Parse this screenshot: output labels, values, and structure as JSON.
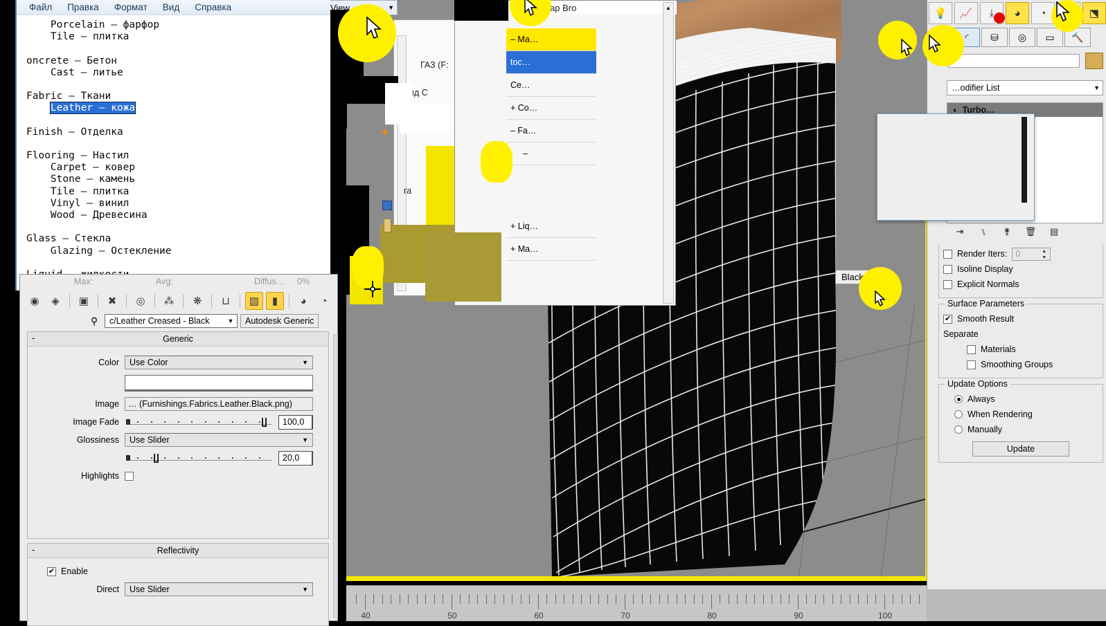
{
  "notepad": {
    "menu": [
      "Файл",
      "Правка",
      "Формат",
      "Вид",
      "Справка"
    ],
    "lines": [
      {
        "text": "    Porcelain – фарфор",
        "selected": false
      },
      {
        "text": "    Tile – плитка",
        "selected": false
      },
      {
        "text": "",
        "selected": false
      },
      {
        "text": "oncrete – Бетон",
        "selected": false
      },
      {
        "text": "    Cast – литье",
        "selected": false
      },
      {
        "text": "",
        "selected": false
      },
      {
        "text": "Fabric – Ткани",
        "selected": false
      },
      {
        "text": "    Leather – кожа",
        "selected": true
      },
      {
        "text": "",
        "selected": false
      },
      {
        "text": "Finish – Отделка",
        "selected": false
      },
      {
        "text": "",
        "selected": false
      },
      {
        "text": "Flooring – Настил",
        "selected": false
      },
      {
        "text": "    Carpet – ковер",
        "selected": false
      },
      {
        "text": "    Stone – камень",
        "selected": false
      },
      {
        "text": "    Tile – плитка",
        "selected": false
      },
      {
        "text": "    Vinyl – винил",
        "selected": false
      },
      {
        "text": "    Wood – Древесина",
        "selected": false
      },
      {
        "text": "",
        "selected": false
      },
      {
        "text": "Glass – Стекла",
        "selected": false
      },
      {
        "text": "    Glazing – Остекление",
        "selected": false
      },
      {
        "text": "",
        "selected": false
      },
      {
        "text": "Liquid – жидкости,",
        "selected": false
      }
    ]
  },
  "viewport_toolbar": {
    "view_label": "View"
  },
  "material_editor": {
    "status": {
      "max_label": "Max:",
      "avg_label": "Avg:",
      "diffuse_label": "Diffus…",
      "diffuse_value": "0%"
    },
    "toolbar_icons": [
      {
        "name": "assign-material-to-selection-icon",
        "glyph": "◉",
        "highlight": false
      },
      {
        "name": "show-shaded-material-in-viewport-icon",
        "glyph": "◈",
        "highlight": false
      },
      {
        "name": "put-material-to-scene-icon",
        "glyph": "▣",
        "highlight": false
      },
      {
        "name": "delete-material-icon",
        "glyph": "✖",
        "highlight": false
      },
      {
        "name": "reset-map-icon",
        "glyph": "◎",
        "highlight": false
      },
      {
        "name": "make-unique-icon",
        "glyph": "⁂",
        "highlight": false
      },
      {
        "name": "put-to-library-icon",
        "glyph": "❋",
        "highlight": false
      },
      {
        "name": "material-id-channel-icon",
        "glyph": "⊔",
        "highlight": false
      },
      {
        "name": "show-map-in-viewport-icon",
        "glyph": "▨",
        "highlight": true
      },
      {
        "name": "show-end-result-icon",
        "glyph": "▮",
        "highlight": true
      },
      {
        "name": "go-to-parent-icon",
        "glyph": "◕",
        "highlight": false
      },
      {
        "name": "go-forward-to-sibling-icon",
        "glyph": "◔",
        "highlight": false
      }
    ],
    "material_name": "c/Leather Creased - Black",
    "material_type": "Autodesk Generic",
    "rollouts": [
      {
        "title": "Generic",
        "rows": [
          {
            "label": "Color",
            "kind": "dropdown",
            "value": "Use Color"
          },
          {
            "label": "",
            "kind": "swatch",
            "value": "#ffffff"
          },
          {
            "label": "Image",
            "kind": "textbox",
            "value": "… (Furnishings.Fabrics.Leather.Black.png)"
          },
          {
            "label": "Image Fade",
            "kind": "slider",
            "value": "100,0",
            "pos": 100
          },
          {
            "label": "Glossiness",
            "kind": "dropdown",
            "value": "Use Slider"
          },
          {
            "label": "",
            "kind": "slider",
            "value": "20,0",
            "pos": 18
          },
          {
            "label": "Highlights",
            "kind": "checkbox",
            "checked": false
          }
        ]
      },
      {
        "title": "Reflectivity",
        "rows": [
          {
            "label": "Enable",
            "kind": "checkbox-left",
            "checked": true
          },
          {
            "label": "Direct",
            "kind": "dropdown",
            "value": "Use Slider"
          }
        ]
      }
    ]
  },
  "browser": {
    "title": "…ap Bro",
    "tree": [
      {
        "text": "– Ma…",
        "state": "hl"
      },
      {
        "text": "toc…",
        "state": "sel"
      },
      {
        "text": "Ce…",
        "state": ""
      },
      {
        "text": "+ Co…",
        "state": ""
      },
      {
        "text": "– Fa…",
        "state": ""
      },
      {
        "text": "–",
        "state": ""
      },
      {
        "text": "+ Liq…",
        "state": ""
      },
      {
        "text": "+ Ma…",
        "state": ""
      }
    ]
  },
  "window_fragment": {
    "line1": "ГАЗ (F:",
    "line2": "ид     С",
    "line3": "га"
  },
  "command_panel": {
    "top_icons": [
      {
        "name": "light-bulb-icon",
        "glyph": "💡",
        "highlight": false
      },
      {
        "name": "curve-editor-icon",
        "glyph": "📈",
        "highlight": false
      },
      {
        "name": "schematic-view-icon",
        "glyph": "⤓",
        "highlight": false
      },
      {
        "name": "material-editor-icon",
        "glyph": "◕",
        "highlight": true
      },
      {
        "name": "material-map-browser-icon",
        "glyph": "◔",
        "highlight": false
      },
      {
        "name": "render-setup-icon",
        "glyph": "⛾",
        "highlight": false
      },
      {
        "name": "render-frame-window-icon",
        "glyph": "⬔",
        "highlight": true
      }
    ],
    "tabs": [
      {
        "name": "tab-create",
        "glyph": "◜",
        "selected": true
      },
      {
        "name": "tab-modify",
        "glyph": "⛁",
        "selected": false
      },
      {
        "name": "tab-hierarchy",
        "glyph": "◎",
        "selected": false
      },
      {
        "name": "tab-display",
        "glyph": "▭",
        "selected": false
      },
      {
        "name": "tab-utilities",
        "glyph": "🔨",
        "selected": false
      }
    ],
    "modifier_list_label": "…odifier List",
    "stack_item": "Turbo…",
    "stack_buttons": [
      {
        "name": "pin-stack-icon",
        "glyph": "⇥"
      },
      {
        "name": "show-end-result-icon",
        "glyph": "⑊"
      },
      {
        "name": "make-unique-icon",
        "glyph": "⚵"
      },
      {
        "name": "remove-modifier-icon",
        "glyph": "🗑"
      },
      {
        "name": "configure-modifier-sets-icon",
        "glyph": "▤"
      }
    ],
    "turbosmooth": {
      "render_iters_label": "Render Iters:",
      "render_iters_value": "0",
      "render_iters_checked": false,
      "isoline_display_label": "Isoline Display",
      "isoline_display_checked": false,
      "explicit_normals_label": "Explicit Normals",
      "explicit_normals_checked": false
    },
    "surface_parameters": {
      "caption": "Surface Parameters",
      "smooth_result_label": "Smooth Result",
      "smooth_result_checked": true,
      "separate_label": "Separate",
      "materials_label": "Materials",
      "materials_checked": false,
      "smoothing_groups_label": "Smoothing Groups",
      "smoothing_groups_checked": false
    },
    "update_options": {
      "caption": "Update Options",
      "options": [
        {
          "label": "Always",
          "selected": true
        },
        {
          "label": "When Rendering",
          "selected": false
        },
        {
          "label": "Manually",
          "selected": false
        }
      ],
      "update_button": "Update"
    }
  },
  "tooltip": {
    "black_label": "Black"
  },
  "ruler": {
    "labels": [
      "40",
      "50",
      "60",
      "70",
      "80",
      "90",
      "100"
    ]
  },
  "colors": {
    "highlight_yellow": "#fff000",
    "selection_blue": "#2a6fd6",
    "viewport_border": "#f2e500",
    "accent_gold": "#d4ad54"
  }
}
